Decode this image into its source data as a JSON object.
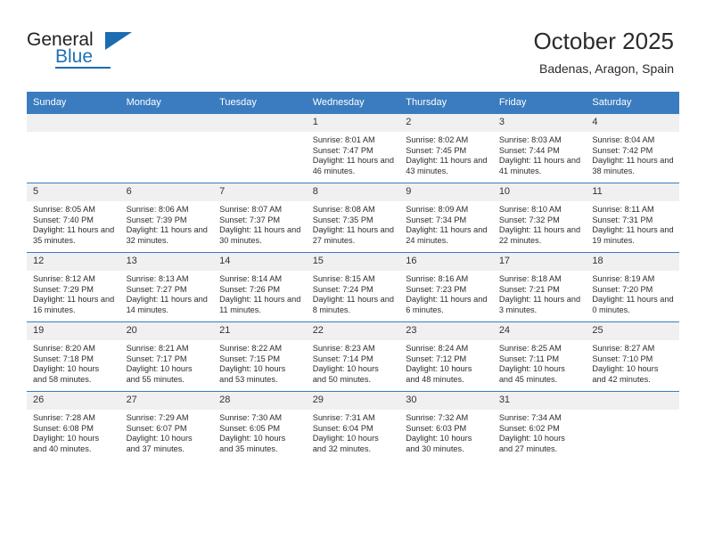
{
  "brand": {
    "name_part1": "General",
    "name_part2": "Blue",
    "accent_color": "#1b6cb0"
  },
  "header": {
    "title": "October 2025",
    "subtitle": "Badenas, Aragon, Spain"
  },
  "calendar": {
    "header_bg": "#3a7cbf",
    "daynum_bg": "#f0f0f0",
    "weekday_headers": [
      "Sunday",
      "Monday",
      "Tuesday",
      "Wednesday",
      "Thursday",
      "Friday",
      "Saturday"
    ],
    "weeks": [
      [
        {
          "day": "",
          "empty": true
        },
        {
          "day": "",
          "empty": true
        },
        {
          "day": "",
          "empty": true
        },
        {
          "day": "1",
          "sunrise": "Sunrise: 8:01 AM",
          "sunset": "Sunset: 7:47 PM",
          "daylight": "Daylight: 11 hours and 46 minutes."
        },
        {
          "day": "2",
          "sunrise": "Sunrise: 8:02 AM",
          "sunset": "Sunset: 7:45 PM",
          "daylight": "Daylight: 11 hours and 43 minutes."
        },
        {
          "day": "3",
          "sunrise": "Sunrise: 8:03 AM",
          "sunset": "Sunset: 7:44 PM",
          "daylight": "Daylight: 11 hours and 41 minutes."
        },
        {
          "day": "4",
          "sunrise": "Sunrise: 8:04 AM",
          "sunset": "Sunset: 7:42 PM",
          "daylight": "Daylight: 11 hours and 38 minutes."
        }
      ],
      [
        {
          "day": "5",
          "sunrise": "Sunrise: 8:05 AM",
          "sunset": "Sunset: 7:40 PM",
          "daylight": "Daylight: 11 hours and 35 minutes."
        },
        {
          "day": "6",
          "sunrise": "Sunrise: 8:06 AM",
          "sunset": "Sunset: 7:39 PM",
          "daylight": "Daylight: 11 hours and 32 minutes."
        },
        {
          "day": "7",
          "sunrise": "Sunrise: 8:07 AM",
          "sunset": "Sunset: 7:37 PM",
          "daylight": "Daylight: 11 hours and 30 minutes."
        },
        {
          "day": "8",
          "sunrise": "Sunrise: 8:08 AM",
          "sunset": "Sunset: 7:35 PM",
          "daylight": "Daylight: 11 hours and 27 minutes."
        },
        {
          "day": "9",
          "sunrise": "Sunrise: 8:09 AM",
          "sunset": "Sunset: 7:34 PM",
          "daylight": "Daylight: 11 hours and 24 minutes."
        },
        {
          "day": "10",
          "sunrise": "Sunrise: 8:10 AM",
          "sunset": "Sunset: 7:32 PM",
          "daylight": "Daylight: 11 hours and 22 minutes."
        },
        {
          "day": "11",
          "sunrise": "Sunrise: 8:11 AM",
          "sunset": "Sunset: 7:31 PM",
          "daylight": "Daylight: 11 hours and 19 minutes."
        }
      ],
      [
        {
          "day": "12",
          "sunrise": "Sunrise: 8:12 AM",
          "sunset": "Sunset: 7:29 PM",
          "daylight": "Daylight: 11 hours and 16 minutes."
        },
        {
          "day": "13",
          "sunrise": "Sunrise: 8:13 AM",
          "sunset": "Sunset: 7:27 PM",
          "daylight": "Daylight: 11 hours and 14 minutes."
        },
        {
          "day": "14",
          "sunrise": "Sunrise: 8:14 AM",
          "sunset": "Sunset: 7:26 PM",
          "daylight": "Daylight: 11 hours and 11 minutes."
        },
        {
          "day": "15",
          "sunrise": "Sunrise: 8:15 AM",
          "sunset": "Sunset: 7:24 PM",
          "daylight": "Daylight: 11 hours and 8 minutes."
        },
        {
          "day": "16",
          "sunrise": "Sunrise: 8:16 AM",
          "sunset": "Sunset: 7:23 PM",
          "daylight": "Daylight: 11 hours and 6 minutes."
        },
        {
          "day": "17",
          "sunrise": "Sunrise: 8:18 AM",
          "sunset": "Sunset: 7:21 PM",
          "daylight": "Daylight: 11 hours and 3 minutes."
        },
        {
          "day": "18",
          "sunrise": "Sunrise: 8:19 AM",
          "sunset": "Sunset: 7:20 PM",
          "daylight": "Daylight: 11 hours and 0 minutes."
        }
      ],
      [
        {
          "day": "19",
          "sunrise": "Sunrise: 8:20 AM",
          "sunset": "Sunset: 7:18 PM",
          "daylight": "Daylight: 10 hours and 58 minutes."
        },
        {
          "day": "20",
          "sunrise": "Sunrise: 8:21 AM",
          "sunset": "Sunset: 7:17 PM",
          "daylight": "Daylight: 10 hours and 55 minutes."
        },
        {
          "day": "21",
          "sunrise": "Sunrise: 8:22 AM",
          "sunset": "Sunset: 7:15 PM",
          "daylight": "Daylight: 10 hours and 53 minutes."
        },
        {
          "day": "22",
          "sunrise": "Sunrise: 8:23 AM",
          "sunset": "Sunset: 7:14 PM",
          "daylight": "Daylight: 10 hours and 50 minutes."
        },
        {
          "day": "23",
          "sunrise": "Sunrise: 8:24 AM",
          "sunset": "Sunset: 7:12 PM",
          "daylight": "Daylight: 10 hours and 48 minutes."
        },
        {
          "day": "24",
          "sunrise": "Sunrise: 8:25 AM",
          "sunset": "Sunset: 7:11 PM",
          "daylight": "Daylight: 10 hours and 45 minutes."
        },
        {
          "day": "25",
          "sunrise": "Sunrise: 8:27 AM",
          "sunset": "Sunset: 7:10 PM",
          "daylight": "Daylight: 10 hours and 42 minutes."
        }
      ],
      [
        {
          "day": "26",
          "sunrise": "Sunrise: 7:28 AM",
          "sunset": "Sunset: 6:08 PM",
          "daylight": "Daylight: 10 hours and 40 minutes."
        },
        {
          "day": "27",
          "sunrise": "Sunrise: 7:29 AM",
          "sunset": "Sunset: 6:07 PM",
          "daylight": "Daylight: 10 hours and 37 minutes."
        },
        {
          "day": "28",
          "sunrise": "Sunrise: 7:30 AM",
          "sunset": "Sunset: 6:05 PM",
          "daylight": "Daylight: 10 hours and 35 minutes."
        },
        {
          "day": "29",
          "sunrise": "Sunrise: 7:31 AM",
          "sunset": "Sunset: 6:04 PM",
          "daylight": "Daylight: 10 hours and 32 minutes."
        },
        {
          "day": "30",
          "sunrise": "Sunrise: 7:32 AM",
          "sunset": "Sunset: 6:03 PM",
          "daylight": "Daylight: 10 hours and 30 minutes."
        },
        {
          "day": "31",
          "sunrise": "Sunrise: 7:34 AM",
          "sunset": "Sunset: 6:02 PM",
          "daylight": "Daylight: 10 hours and 27 minutes."
        },
        {
          "day": "",
          "empty": true
        }
      ]
    ]
  }
}
